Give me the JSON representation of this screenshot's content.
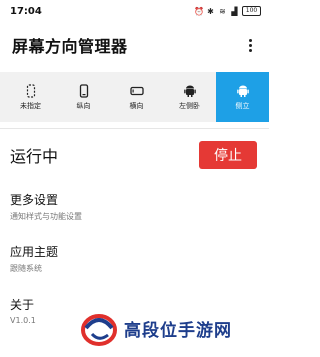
{
  "status": {
    "time": "17:04",
    "battery": "100"
  },
  "app": {
    "title": "屏幕方向管理器"
  },
  "modes": [
    {
      "label": "未指定",
      "icon": "unspecified-icon"
    },
    {
      "label": "纵向",
      "icon": "portrait-icon"
    },
    {
      "label": "横向",
      "icon": "landscape-icon"
    },
    {
      "label": "左侧卧",
      "icon": "android-left-icon"
    },
    {
      "label": "侧立",
      "icon": "android-upright-icon"
    }
  ],
  "selected_mode": "侧立",
  "running": {
    "label": "运行中",
    "stop_label": "停止"
  },
  "settings": [
    {
      "title": "更多设置",
      "subtitle": "通知样式与功能设置"
    },
    {
      "title": "应用主题",
      "subtitle": "跟随系统"
    },
    {
      "title": "关于",
      "subtitle": "V1.0.1"
    }
  ],
  "watermark": {
    "text": "高段位手游网"
  },
  "colors": {
    "accent": "#1ea0e6",
    "stop": "#e53935"
  }
}
